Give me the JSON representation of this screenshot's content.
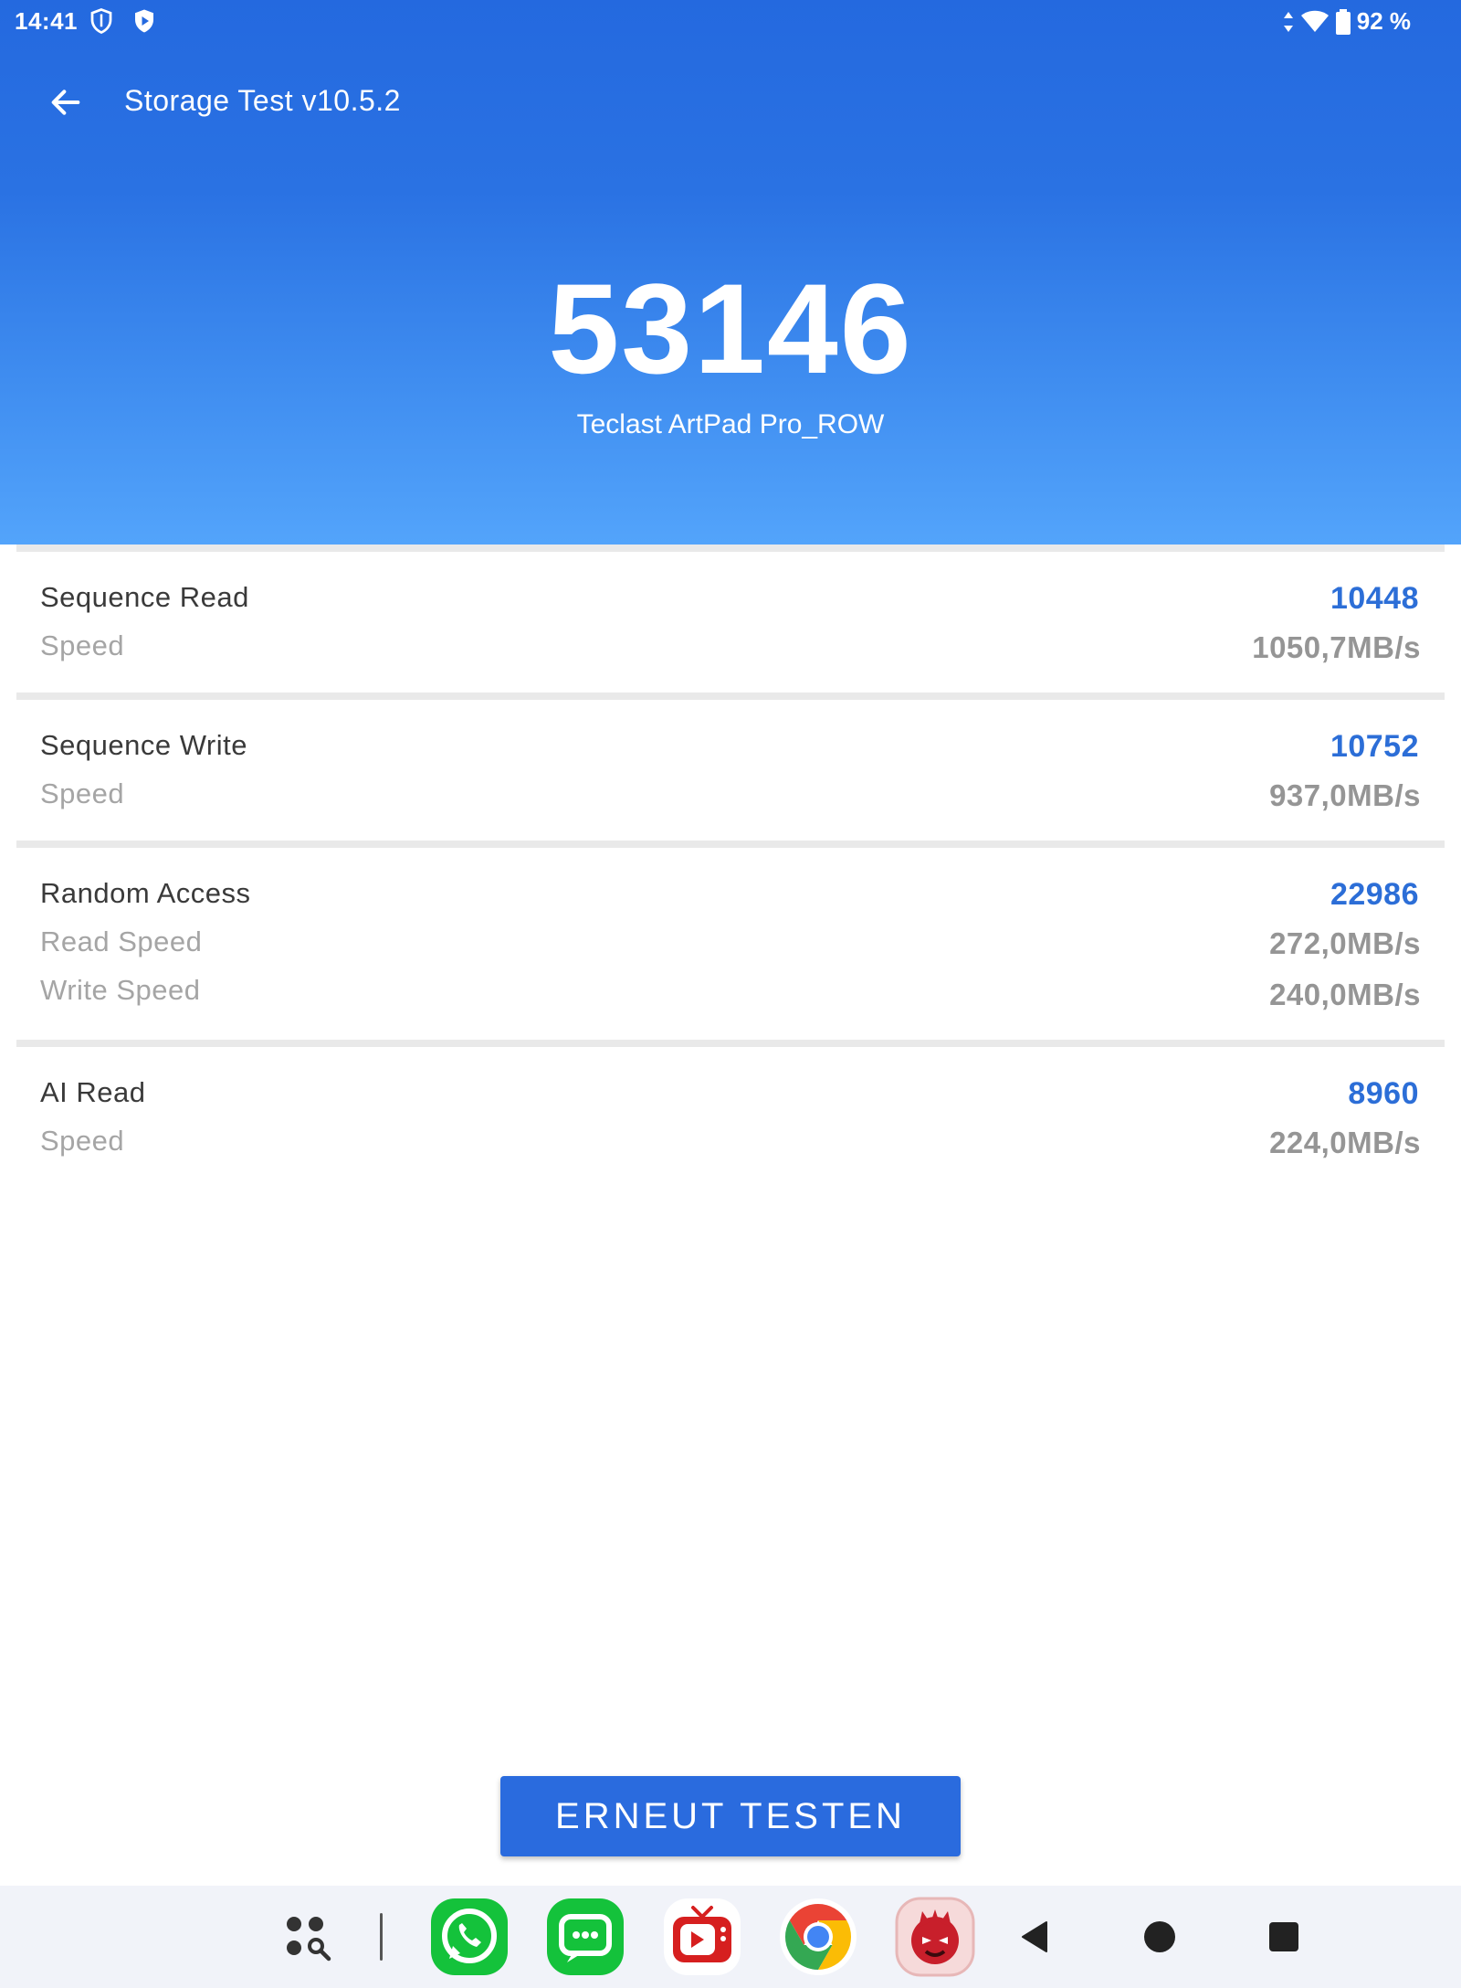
{
  "status_bar": {
    "time": "14:41",
    "battery": "92 %",
    "icons": [
      "shield-icon",
      "play-shield-icon",
      "data-arrows-icon",
      "wifi-icon",
      "battery-icon"
    ]
  },
  "toolbar": {
    "title": "Storage Test v10.5.2",
    "back_icon": "arrow-back-icon"
  },
  "summary": {
    "score": "53146",
    "device": "Teclast ArtPad Pro_ROW"
  },
  "results": [
    {
      "title": "Sequence Read",
      "score": "10448",
      "metrics": [
        {
          "label": "Speed",
          "value": "1050,7MB/s"
        }
      ]
    },
    {
      "title": "Sequence Write",
      "score": "10752",
      "metrics": [
        {
          "label": "Speed",
          "value": "937,0MB/s"
        }
      ]
    },
    {
      "title": "Random Access",
      "score": "22986",
      "metrics": [
        {
          "label": "Read Speed",
          "value": "272,0MB/s"
        },
        {
          "label": "Write Speed",
          "value": "240,0MB/s"
        }
      ]
    },
    {
      "title": "AI Read",
      "score": "8960",
      "metrics": [
        {
          "label": "Speed",
          "value": "224,0MB/s"
        }
      ]
    }
  ],
  "retest_label": "ERNEUT TESTEN",
  "colors": {
    "header_top": "#2469df",
    "header_bottom": "#53a4fb",
    "score_blue": "#2c6ed7",
    "button_blue": "#2a6bde",
    "value_gray": "#959595"
  },
  "taskbar": {
    "apps": [
      "app-drawer-icon",
      "whatsapp-icon",
      "messages-icon",
      "tv-app-icon",
      "chrome-icon",
      "antutu-icon"
    ],
    "nav": [
      "back-nav-icon",
      "home-nav-icon",
      "recents-nav-icon"
    ]
  }
}
